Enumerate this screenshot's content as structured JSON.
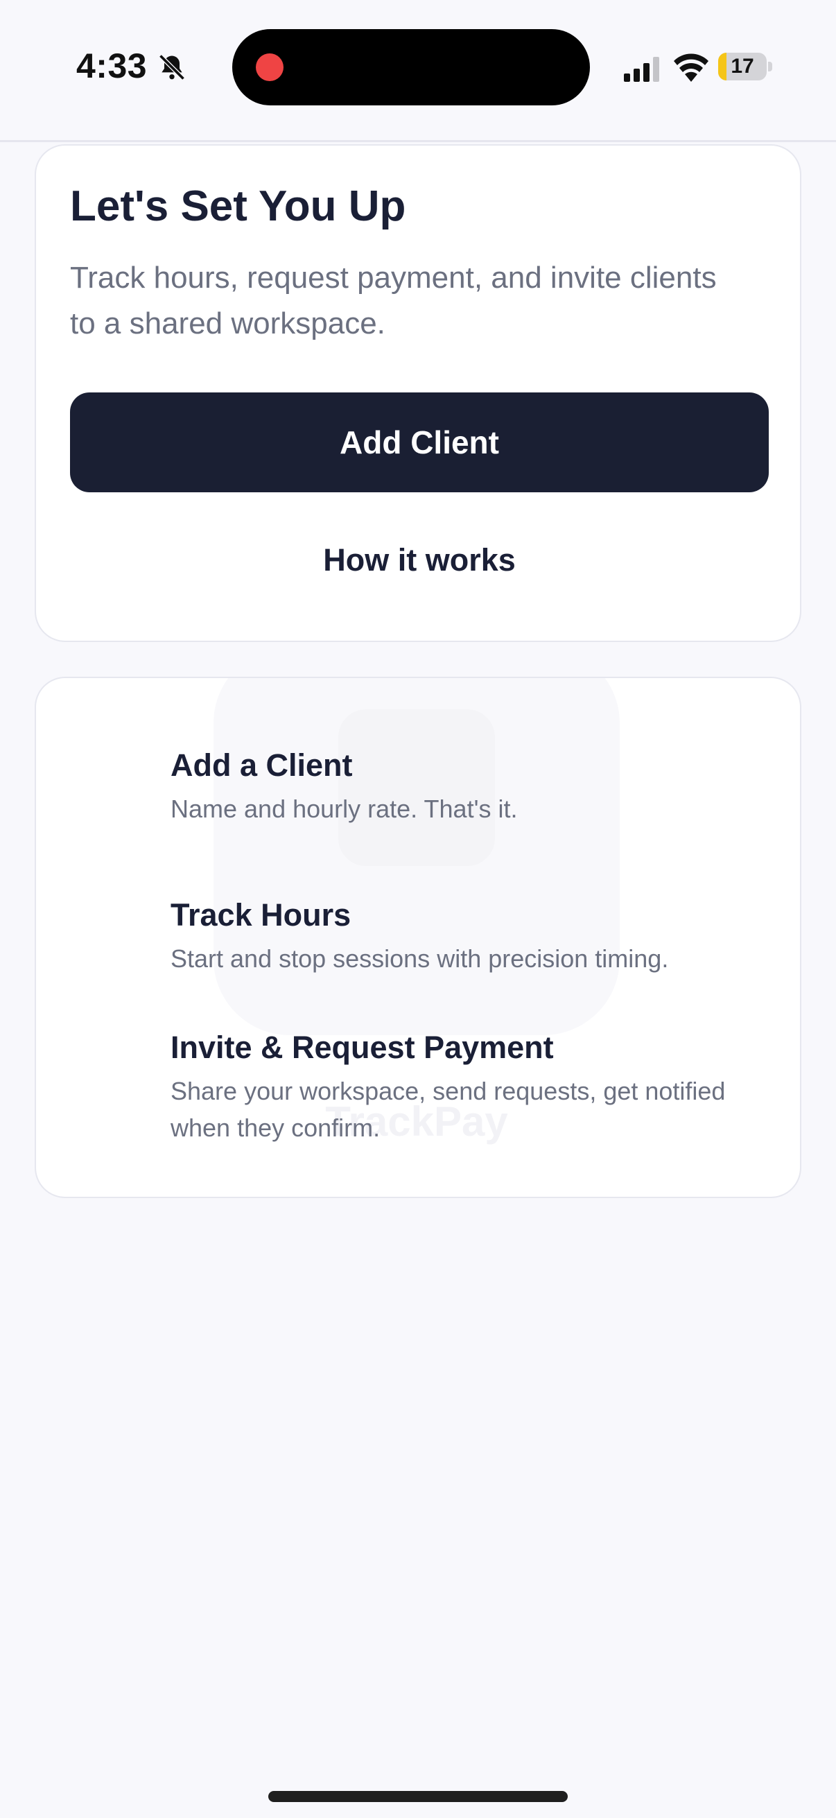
{
  "status_bar": {
    "time": "4:33",
    "battery": "17",
    "battery_level": 0.17
  },
  "setup_card": {
    "title": "Let's Set You Up",
    "subtitle": "Track hours, request payment, and invite clients to a shared workspace.",
    "primary_button": "Add Client",
    "secondary_link": "How it works"
  },
  "steps": [
    {
      "title": "Add a Client",
      "description": "Name and hourly rate. That's it."
    },
    {
      "title": "Track Hours",
      "description": "Start and stop sessions with precision timing."
    },
    {
      "title": "Invite & Request Payment",
      "description": "Share your workspace, send requests, get notified when they confirm."
    }
  ],
  "watermark_text": "TrackPay",
  "colors": {
    "background": "#f8f8fc",
    "primary_button": "#1a1f33",
    "title_text": "#1a1f36",
    "muted_text": "#6b7080",
    "battery_fill": "#f5c518",
    "recording_dot": "#ef4444"
  }
}
